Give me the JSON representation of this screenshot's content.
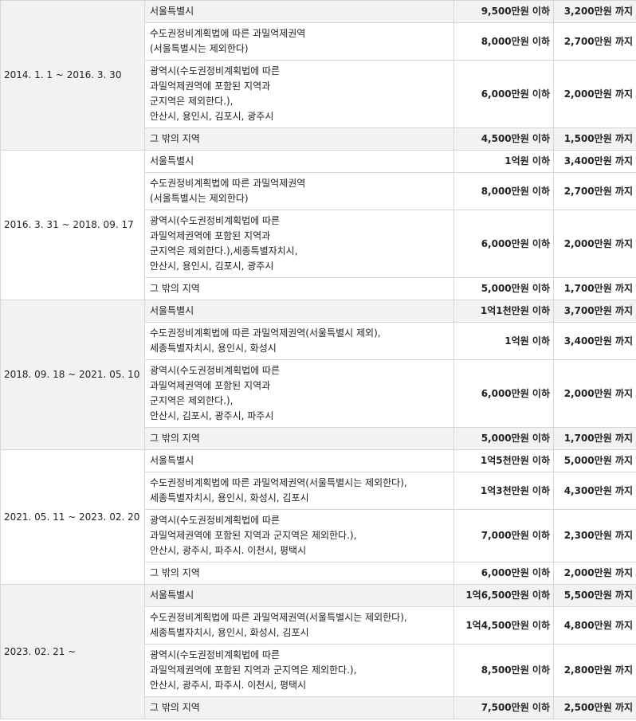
{
  "groups": [
    {
      "period": "2014. 1. 1 ~ 2016. 3. 30",
      "rows": [
        {
          "region": "서울특별시",
          "deposit": "9,500만원 이하",
          "amount": "3,200만원 까지"
        },
        {
          "region": "수도권정비계획법에 따른 과밀억제권역\n(서울특별시는 제외한다)",
          "deposit": "8,000만원 이하",
          "amount": "2,700만원 까지"
        },
        {
          "region": "광역시(수도권정비계획법에 따른\n과밀억제권역에 포함된 지역과\n군지역은 제외한다.),\n안산시, 용인시, 김포시, 광주시",
          "deposit": "6,000만원 이하",
          "amount": "2,000만원 까지"
        },
        {
          "region": "그 밖의 지역",
          "deposit": "4,500만원 이하",
          "amount": "1,500만원 까지"
        }
      ]
    },
    {
      "period": "2016. 3. 31 ~ 2018. 09. 17",
      "rows": [
        {
          "region": "서울특별시",
          "deposit": "1억원 이하",
          "amount": "3,400만원 까지"
        },
        {
          "region": "수도권정비계획법에 따른 과밀억제권역\n(서울특별시는 제외한다)",
          "deposit": "8,000만원 이하",
          "amount": "2,700만원 까지"
        },
        {
          "region": "광역시(수도권정비계획법에 따른\n과밀억제권역에 포함된 지역과\n군지역은 제외한다.),세종특별자치시,\n안산시, 용인시, 김포시, 광주시",
          "deposit": "6,000만원 이하",
          "amount": "2,000만원 까지"
        },
        {
          "region": "그 밖의 지역",
          "deposit": "5,000만원 이하",
          "amount": "1,700만원 까지"
        }
      ]
    },
    {
      "period": "2018. 09. 18 ~ 2021. 05. 10",
      "rows": [
        {
          "region": "서울특별시",
          "deposit": "1억1천만원 이하",
          "amount": "3,700만원 까지"
        },
        {
          "region": "수도권정비계획법에 따른 과밀억제권역(서울특별시 제외),\n세종특별자치시, 용인시, 화성시",
          "deposit": "1억원 이하",
          "amount": "3,400만원 까지"
        },
        {
          "region": "광역시(수도권정비계획법에 따른\n과밀억제권역에 포함된 지역과\n군지역은 제외한다.),\n안산시, 김포시, 광주시, 파주시",
          "deposit": "6,000만원 이하",
          "amount": "2,000만원 까지"
        },
        {
          "region": "그 밖의 지역",
          "deposit": "5,000만원 이하",
          "amount": "1,700만원 까지"
        }
      ]
    },
    {
      "period": "2021. 05. 11 ~ 2023. 02. 20",
      "rows": [
        {
          "region": "서울특별시",
          "deposit": "1억5천만원 이하",
          "amount": "5,000만원 까지"
        },
        {
          "region": "수도권정비계획법에 따른 과밀억제권역(서울특별시는 제외한다),\n세종특별자치시, 용인시, 화성시, 김포시",
          "deposit": "1억3천만원 이하",
          "amount": "4,300만원 까지"
        },
        {
          "region": "광역시(수도권정비계획법에 따른\n과밀억제권역에 포함된 지역과 군지역은 제외한다.),\n안산시, 광주시, 파주시. 이천시, 평택시",
          "deposit": "7,000만원 이하",
          "amount": "2,300만원 까지"
        },
        {
          "region": "그 밖의 지역",
          "deposit": "6,000만원 이하",
          "amount": "2,000만원 까지"
        }
      ]
    },
    {
      "period": "2023. 02. 21 ~",
      "rows": [
        {
          "region": "서울특별시",
          "deposit": "1억6,500만원 이하",
          "amount": "5,500만원 까지"
        },
        {
          "region": "수도권정비계획법에 따른 과밀억제권역(서울특별시는 제외한다),\n세종특별자치시, 용인시, 화성시, 김포시",
          "deposit": "1억4,500만원 이하",
          "amount": "4,800만원 까지"
        },
        {
          "region": "광역시(수도권정비계획법에 따른\n과밀억제권역에 포함된 지역과 군지역은 제외한다.),\n안산시, 광주시, 파주시. 이천시, 평택시",
          "deposit": "8,500만원 이하",
          "amount": "2,800만원 까지"
        },
        {
          "region": "그 밖의 지역",
          "deposit": "7,500만원 이하",
          "amount": "2,500만원 까지"
        }
      ]
    }
  ]
}
